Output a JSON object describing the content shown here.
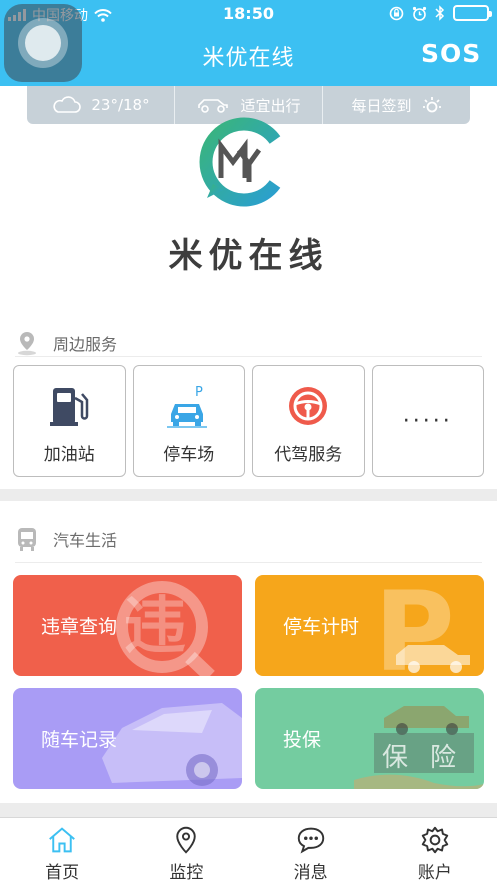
{
  "status_bar": {
    "carrier": "中国移动",
    "time": "18:50"
  },
  "nav": {
    "title": "米优在线",
    "sos_label": "SOS"
  },
  "info_bar": {
    "weather": "23°/18°",
    "travel": "适宜出行",
    "checkin": "每日签到"
  },
  "logo": {
    "text": "米优在线",
    "mark_letters": "MYC"
  },
  "nearby": {
    "title": "周边服务",
    "items": [
      {
        "label": "加油站",
        "icon": "gas-station-icon"
      },
      {
        "label": "停车场",
        "icon": "parking-icon"
      },
      {
        "label": "代驾服务",
        "icon": "steering-wheel-icon"
      },
      {
        "label": "·····",
        "icon": "more-icon"
      }
    ]
  },
  "car_life": {
    "title": "汽车生活",
    "cards": [
      {
        "label": "违章查询",
        "color": "#f0604b",
        "icon": "violation-icon"
      },
      {
        "label": "停车计时",
        "color": "#f6a61b",
        "icon": "parking-timer-icon"
      },
      {
        "label": "随车记录",
        "color": "#a99cf5",
        "icon": "car-record-icon"
      },
      {
        "label": "投保",
        "color": "#74cca0",
        "icon": "insurance-icon"
      }
    ]
  },
  "tabs": [
    {
      "label": "首页",
      "icon": "home-icon",
      "active": true
    },
    {
      "label": "监控",
      "icon": "location-pin-icon",
      "active": false
    },
    {
      "label": "消息",
      "icon": "chat-bubble-icon",
      "active": false
    },
    {
      "label": "账户",
      "icon": "gear-icon",
      "active": false
    }
  ],
  "colors": {
    "header": "#3cc0f2",
    "accent": "#3cc0f2"
  }
}
